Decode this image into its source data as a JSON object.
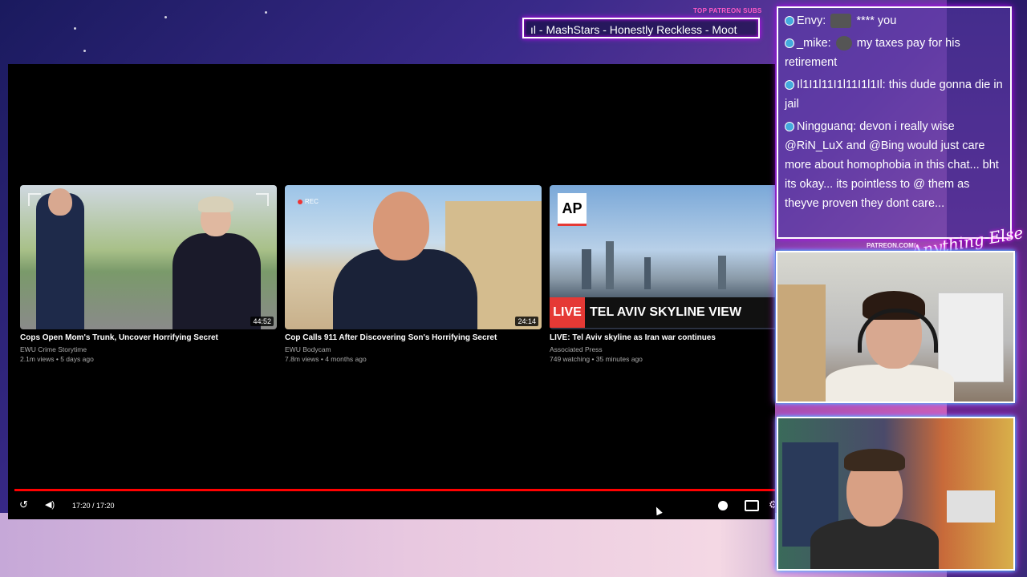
{
  "patreon": {
    "label": "TOP PATREON SUBS",
    "ticker": "ıl - MashStars - Honestly Reckless - Moot"
  },
  "player": {
    "cards": [
      {
        "title": "Cops Open Mom's Trunk, Uncover Horrifying Secret",
        "channel": "EWU Crime Storytime",
        "meta": "2.1m views • 5 days ago",
        "duration": "44:52"
      },
      {
        "title": "Cop Calls 911 After Discovering Son's Horrifying Secret",
        "channel": "EWU Bodycam",
        "meta": "7.8m views • 4 months ago",
        "duration": "24:14",
        "rec": "REC"
      },
      {
        "title": "LIVE: Tel Aviv skyline as Iran war continues",
        "channel": "Associated Press",
        "meta": "749 watching • 35 minutes ago",
        "live_badge": "LIVE",
        "banner": "TEL AVIV SKYLINE VIEW",
        "logo": "AP"
      }
    ],
    "time": "17:20 / 17:20",
    "progress": 1.0
  },
  "chat": {
    "messages": [
      {
        "user": "Envy:",
        "text": "**** you"
      },
      {
        "user": "_mike:",
        "text": "my taxes pay for his retirement"
      },
      {
        "user": "Il1I1l11I1l11I1l1Il:",
        "text": "this dude gonna die in jail"
      },
      {
        "user": "Ningguanq:",
        "text": "devon i really wise @RiN_LuX and @Bing would just care more about homophobia in this chat... bht its okay... its pointless to @ them as theyve proven they dont care..."
      }
    ]
  },
  "overlay": {
    "patreon_url": "PATREON.COM/",
    "signature": "Anything Else"
  },
  "colors": {
    "accent": "#ff5ac8",
    "progress": "#ff0000",
    "live": "#e53935"
  }
}
